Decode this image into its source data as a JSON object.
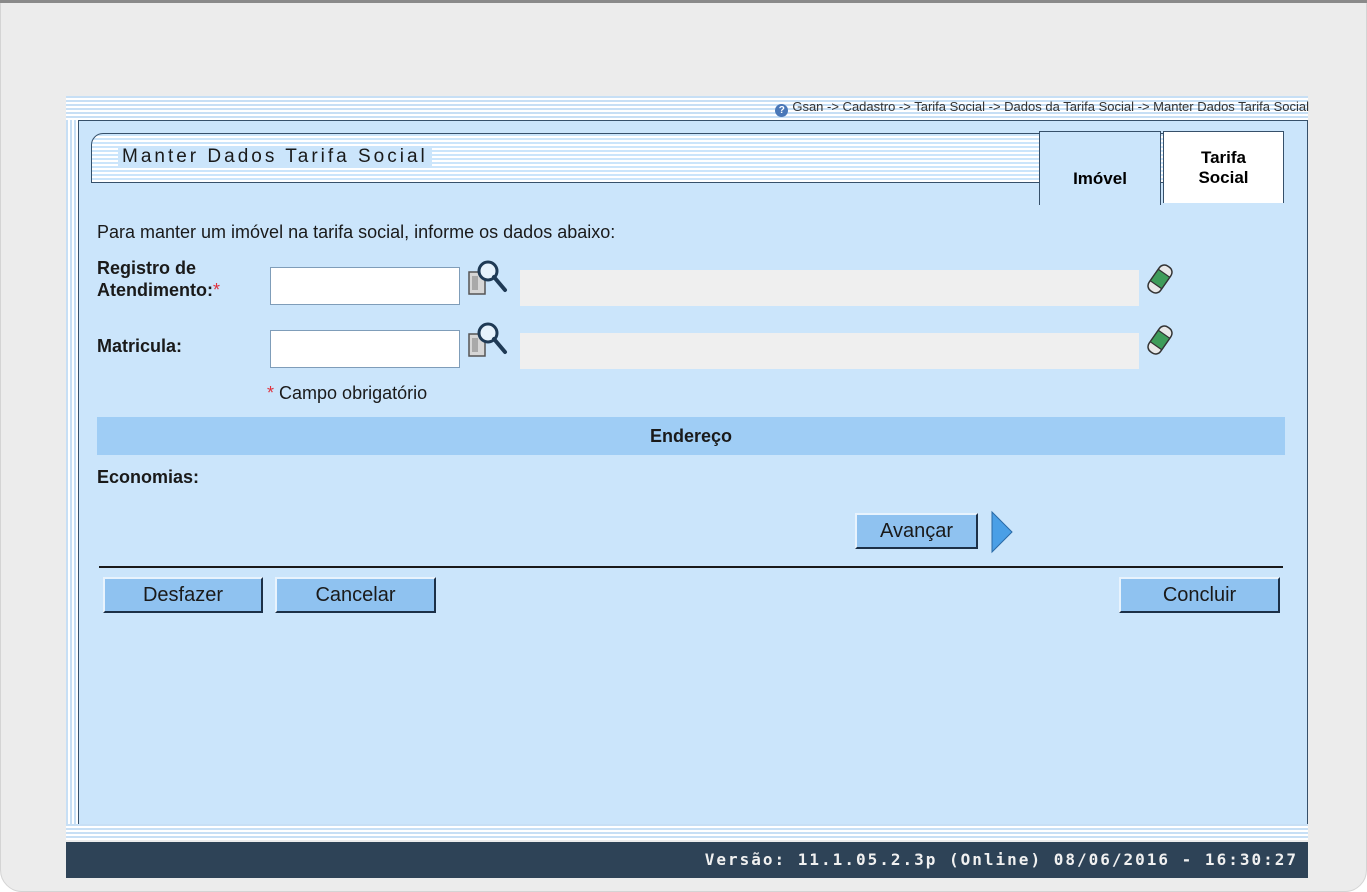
{
  "breadcrumb": {
    "help_icon": "?",
    "path": "Gsan -> Cadastro -> Tarifa Social -> Dados da Tarifa Social -> Manter Dados Tarifa Social"
  },
  "page": {
    "title": "Manter Dados Tarifa Social",
    "instructions": "Para manter um imóvel na tarifa social, informe os dados abaixo:"
  },
  "tabs": [
    {
      "label": "Imóvel",
      "active": true
    },
    {
      "label_line1": "Tarifa",
      "label_line2": "Social",
      "active": false
    }
  ],
  "form": {
    "registro_label_line1": "Registro de",
    "registro_label_line2": "Atendimento:",
    "registro_value": "",
    "registro_description": "",
    "matricula_label": "Matricula:",
    "matricula_value": "",
    "matricula_description": "",
    "required_marker": "*",
    "required_note": "Campo obrigatório"
  },
  "section": {
    "endereco_header": "Endereço",
    "economias_label": "Economias:"
  },
  "buttons": {
    "avancar": "Avançar",
    "desfazer": "Desfazer",
    "cancelar": "Cancelar",
    "concluir": "Concluir"
  },
  "footer": {
    "version": "Versão: 11.1.05.2.3p (Online) 08/06/2016 - 16:30:27"
  },
  "icons": {
    "search": "magnifier-icon",
    "clear": "eraser-icon",
    "next": "arrow-right-icon"
  },
  "colors": {
    "panel_bg": "#cbe5fb",
    "section_bg": "#9fcdf5",
    "button_bg": "#8fc2f0",
    "footer_bg": "#2e4357",
    "required": "#e0303c"
  }
}
